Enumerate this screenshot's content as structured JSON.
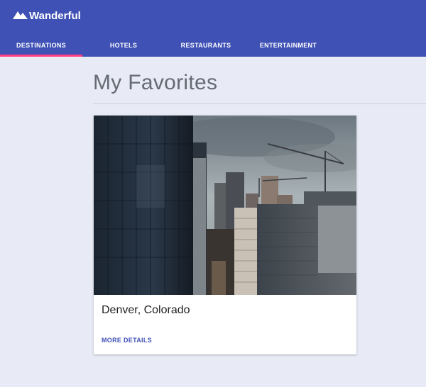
{
  "app": {
    "brand_name": "Wanderful",
    "brand_icon": "mountain-icon",
    "header_color": "#3f51b5",
    "accent_color": "#ff4081"
  },
  "nav": {
    "tabs": [
      {
        "label": "DESTINATIONS",
        "active": true
      },
      {
        "label": "HOTELS",
        "active": false
      },
      {
        "label": "RESTAURANTS",
        "active": false
      },
      {
        "label": "ENTERTAINMENT",
        "active": false
      }
    ]
  },
  "main": {
    "title": "My Favorites",
    "cards": [
      {
        "title": "Denver, Colorado",
        "action_label": "MORE DETAILS",
        "image": "city-skyline-photo"
      }
    ]
  }
}
